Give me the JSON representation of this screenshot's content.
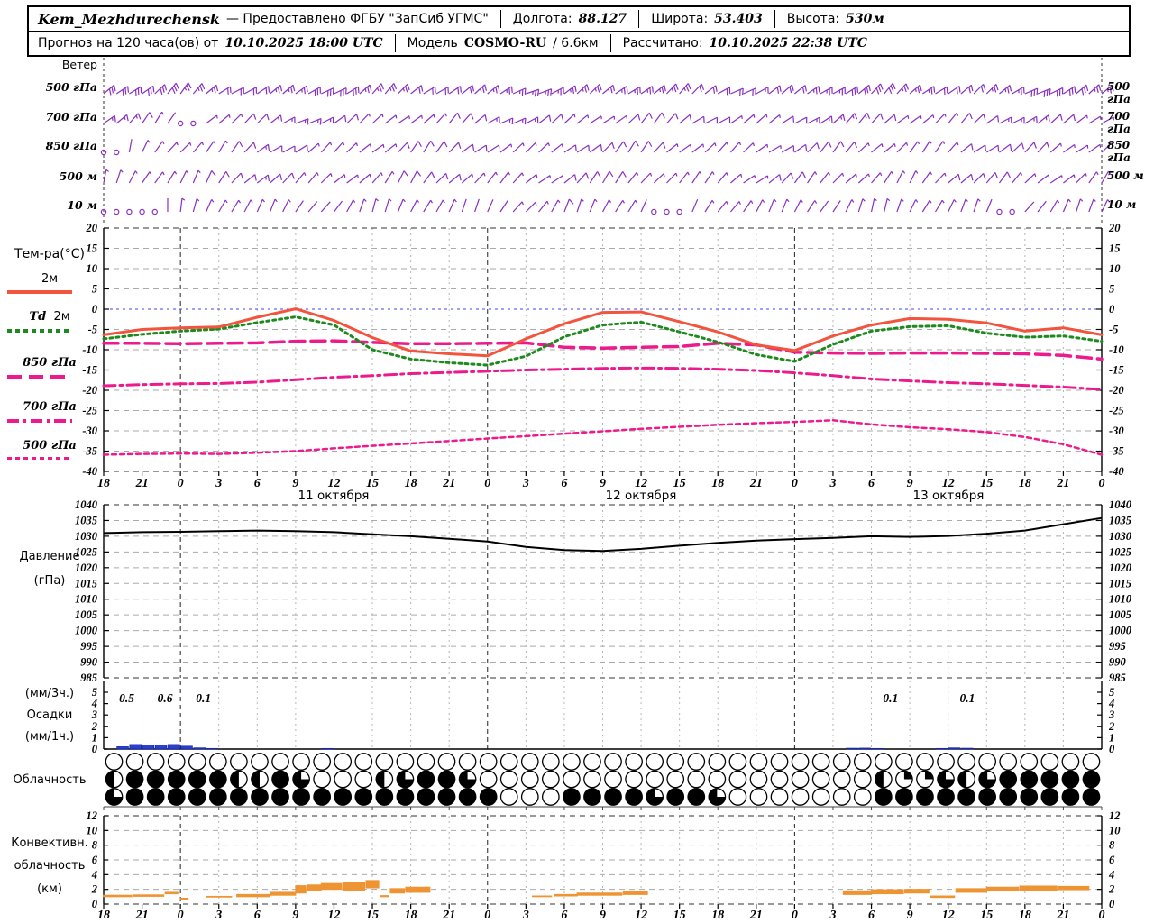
{
  "header": {
    "station": "Kem_Mezhdurechensk",
    "provider": "— Предоставлено ФГБУ \"ЗапСиб УГМС\"",
    "sep": "",
    "lon_label": "Долгота:",
    "lon": "88.127",
    "lat_label": "Широта:",
    "lat": "53.403",
    "alt_label": "Высота:",
    "alt": "530м",
    "forecast_label": "Прогноз на 120 часа(ов) от",
    "forecast_time": "10.10.2025 18:00 UTC",
    "model_label": "Модель",
    "model": "COSMO-RU",
    "model_res": "/ 6.6км",
    "calc_label": "Рассчитано:",
    "calc_time": "10.10.2025 22:38 UTC"
  },
  "sections": {
    "wind_title": "Ветер",
    "temp_title": "Тем-ра(°C)",
    "legend": {
      "t2m": "2м",
      "td_it": "Td",
      "td_rest": "2м",
      "p850": "850 гПа",
      "p700": "700 гПа",
      "p500": "500 гПа"
    },
    "pressure": [
      "Давление",
      "(гПа)"
    ],
    "precip": [
      "(мм/3ч.)",
      "Осадки",
      "(мм/1ч.)"
    ],
    "cloud": "Облачность",
    "conv": [
      "Конвективн.",
      "облачность",
      "(км)"
    ]
  },
  "axis": {
    "hours": [
      "18",
      "21",
      "0",
      "3",
      "6",
      "9",
      "12",
      "15",
      "18",
      "21",
      "0",
      "3",
      "6",
      "9",
      "12",
      "15",
      "18",
      "21",
      "0",
      "3",
      "6",
      "9",
      "12",
      "15",
      "18",
      "21",
      "0"
    ],
    "hour_step": 3,
    "total_hours": 78,
    "dates": [
      "11 октября",
      "12 октября",
      "13 октября"
    ]
  },
  "colors": {
    "wind": "#8a2fc0",
    "t2m": "#f2543d",
    "td": "#1e8a1e",
    "magenta": "#ec1a8c",
    "zero_line": "#4040ff",
    "precip": "#2a3fd4",
    "conv": "#ef9433",
    "grid": "#b5b5b5",
    "grid_major": "#333333"
  },
  "chart_data": [
    {
      "id": "wind",
      "type": "wind-barbs",
      "title": "Ветер",
      "levels": [
        {
          "label": "500 гПа",
          "dirs": [
            50,
            48,
            45,
            50,
            58,
            60,
            55,
            50,
            48,
            52,
            60,
            62,
            58,
            52,
            48,
            50,
            55,
            60,
            58,
            52,
            50,
            48,
            50,
            55,
            58,
            60,
            55
          ],
          "spds": [
            30,
            30,
            28,
            25,
            25,
            28,
            30,
            28,
            25,
            22,
            25,
            28,
            30,
            28,
            25,
            22,
            20,
            22,
            25,
            28,
            30,
            28,
            25,
            25,
            28,
            30,
            28
          ]
        },
        {
          "label": "700 гПа",
          "dirs": [
            45,
            42,
            40,
            45,
            55,
            60,
            58,
            50,
            45,
            48,
            55,
            60,
            55,
            48,
            45,
            50,
            55,
            58,
            55,
            50,
            48,
            45,
            48,
            52,
            55,
            58,
            52
          ],
          "spds": [
            15,
            12,
            0,
            10,
            12,
            15,
            12,
            10,
            8,
            10,
            12,
            15,
            12,
            10,
            8,
            10,
            12,
            10,
            12,
            15,
            12,
            10,
            10,
            12,
            15,
            12,
            10
          ]
        },
        {
          "label": "850 гПа",
          "dirs": [
            0,
            30,
            35,
            40,
            50,
            55,
            50,
            45,
            40,
            45,
            50,
            55,
            50,
            45,
            40,
            45,
            50,
            52,
            50,
            45,
            42,
            40,
            45,
            50,
            52,
            50,
            45
          ],
          "spds": [
            0,
            5,
            8,
            10,
            12,
            10,
            8,
            10,
            12,
            10,
            8,
            10,
            12,
            10,
            8,
            10,
            10,
            8,
            10,
            12,
            10,
            8,
            8,
            10,
            12,
            10,
            8
          ]
        },
        {
          "label": "500 м",
          "dirs": [
            20,
            25,
            30,
            35,
            45,
            50,
            45,
            40,
            35,
            40,
            45,
            50,
            45,
            40,
            35,
            40,
            45,
            48,
            45,
            40,
            38,
            35,
            40,
            45,
            48,
            45,
            40
          ],
          "spds": [
            8,
            8,
            10,
            10,
            12,
            10,
            8,
            8,
            10,
            10,
            8,
            10,
            10,
            8,
            8,
            10,
            10,
            8,
            8,
            10,
            10,
            8,
            8,
            10,
            10,
            8,
            8
          ]
        },
        {
          "label": "10 м",
          "dirs": [
            0,
            0,
            15,
            20,
            30,
            35,
            30,
            25,
            20,
            25,
            30,
            35,
            30,
            25,
            20,
            25,
            30,
            32,
            30,
            25,
            22,
            20,
            25,
            30,
            32,
            30,
            25
          ],
          "spds": [
            0,
            0,
            4,
            5,
            8,
            6,
            5,
            4,
            5,
            6,
            5,
            6,
            8,
            6,
            5,
            4,
            5,
            6,
            5,
            6,
            8,
            6,
            5,
            4,
            5,
            6,
            5
          ]
        }
      ]
    },
    {
      "id": "temperature",
      "type": "line",
      "ylabel": "Тем-ра(°C)",
      "ylim": [
        -40,
        20
      ],
      "ytick": 5,
      "series": [
        {
          "name": "2м",
          "style": "solid",
          "values": [
            -6.3,
            -5.0,
            -4.6,
            -4.4,
            -2.0,
            0.1,
            -2.8,
            -7.0,
            -10.3,
            -11.0,
            -11.5,
            -7.3,
            -3.6,
            -0.8,
            -0.7,
            -3.1,
            -5.6,
            -8.8,
            -10.2,
            -6.6,
            -3.9,
            -2.3,
            -2.5,
            -3.4,
            -5.4,
            -4.6,
            -6.3
          ]
        },
        {
          "name": "Td 2м",
          "style": "dotted",
          "values": [
            -7.3,
            -6.2,
            -5.4,
            -4.9,
            -3.3,
            -1.9,
            -3.9,
            -10.0,
            -12.3,
            -13.2,
            -13.8,
            -11.6,
            -6.8,
            -3.9,
            -3.2,
            -5.6,
            -8.1,
            -11.2,
            -12.9,
            -8.7,
            -5.4,
            -4.3,
            -4.1,
            -5.9,
            -6.9,
            -6.6,
            -7.9
          ]
        },
        {
          "name": "850 гПа",
          "style": "longdash",
          "values": [
            -8.4,
            -8.4,
            -8.5,
            -8.4,
            -8.3,
            -7.9,
            -7.8,
            -8.2,
            -8.5,
            -8.5,
            -8.4,
            -8.3,
            -9.4,
            -9.6,
            -9.4,
            -9.2,
            -8.4,
            -8.8,
            -10.6,
            -10.8,
            -10.9,
            -10.8,
            -10.8,
            -10.9,
            -11.0,
            -11.4,
            -12.3
          ]
        },
        {
          "name": "700 гПа",
          "style": "dashdot",
          "values": [
            -18.9,
            -18.6,
            -18.4,
            -18.3,
            -18.0,
            -17.4,
            -16.8,
            -16.4,
            -15.9,
            -15.6,
            -15.3,
            -15.0,
            -14.8,
            -14.6,
            -14.5,
            -14.6,
            -14.8,
            -15.1,
            -15.7,
            -16.4,
            -17.2,
            -17.7,
            -18.1,
            -18.4,
            -18.8,
            -19.2,
            -19.8
          ]
        },
        {
          "name": "500 гПа",
          "style": "finedash",
          "values": [
            -35.9,
            -35.7,
            -35.6,
            -35.7,
            -35.4,
            -35.0,
            -34.3,
            -33.7,
            -33.1,
            -32.5,
            -31.9,
            -31.3,
            -30.7,
            -30.1,
            -29.5,
            -29.0,
            -28.5,
            -28.1,
            -27.8,
            -27.4,
            -28.4,
            -29.1,
            -29.6,
            -30.3,
            -31.5,
            -33.3,
            -35.9
          ]
        }
      ]
    },
    {
      "id": "pressure",
      "type": "line",
      "ylabel": "Давление (гПа)",
      "ylim": [
        985,
        1040
      ],
      "ytick": 5,
      "series": [
        {
          "name": "Давление",
          "values": [
            1031.0,
            1031.3,
            1031.4,
            1031.6,
            1031.8,
            1031.6,
            1031.3,
            1030.6,
            1030.0,
            1029.2,
            1028.3,
            1026.6,
            1025.6,
            1025.3,
            1026.0,
            1027.0,
            1027.9,
            1028.6,
            1029.1,
            1029.5,
            1030.0,
            1029.8,
            1030.1,
            1030.8,
            1031.8,
            1033.8,
            1035.8
          ]
        }
      ]
    },
    {
      "id": "precip",
      "type": "bar",
      "ylabel": "Осадки (мм/1ч.)",
      "ylim": [
        0,
        5
      ],
      "ytick": 1,
      "bars_1h": [
        [
          1,
          0.2
        ],
        [
          2,
          0.4
        ],
        [
          3,
          0.35
        ],
        [
          4,
          0.35
        ],
        [
          5,
          0.4
        ],
        [
          6,
          0.25
        ],
        [
          7,
          0.1
        ],
        [
          8,
          0.05
        ],
        [
          17,
          0.05
        ],
        [
          58,
          0.07
        ],
        [
          59,
          0.08
        ],
        [
          60,
          0.05
        ],
        [
          65,
          0.05
        ],
        [
          66,
          0.1
        ],
        [
          67,
          0.07
        ]
      ],
      "labels_3h": [
        [
          1.8,
          "0.5"
        ],
        [
          4.8,
          "0.6"
        ],
        [
          7.8,
          "0.1"
        ],
        [
          61.5,
          "0.1"
        ],
        [
          67.5,
          "0.1"
        ]
      ]
    },
    {
      "id": "cloud",
      "type": "cloud-cover",
      "ylabel": "Облачность",
      "fill_unit": "eighths",
      "rows": [
        {
          "values": [
            0,
            0,
            0,
            0,
            0,
            0,
            0,
            0,
            0,
            0,
            0,
            0,
            0,
            0,
            0,
            0,
            0,
            0,
            0,
            0,
            0,
            0,
            0,
            0,
            0,
            0,
            0,
            0,
            0,
            0,
            0,
            0,
            0,
            0,
            0,
            0,
            0,
            0,
            0,
            0,
            0,
            0,
            0,
            0,
            0,
            0,
            0,
            0
          ]
        },
        {
          "values": [
            4,
            8,
            8,
            8,
            8,
            8,
            4,
            4,
            8,
            6,
            0,
            0,
            0,
            4,
            6,
            8,
            8,
            6,
            0,
            0,
            0,
            0,
            0,
            0,
            0,
            0,
            0,
            0,
            0,
            0,
            0,
            0,
            0,
            0,
            0,
            0,
            0,
            4,
            2,
            2,
            6,
            4,
            6,
            8,
            8,
            8,
            8,
            8
          ]
        },
        {
          "values": [
            6,
            8,
            8,
            8,
            8,
            8,
            8,
            8,
            8,
            8,
            8,
            8,
            8,
            8,
            8,
            8,
            8,
            8,
            8,
            0,
            0,
            0,
            8,
            8,
            8,
            8,
            6,
            8,
            8,
            6,
            0,
            0,
            0,
            0,
            0,
            0,
            0,
            8,
            8,
            8,
            8,
            8,
            8,
            8,
            8,
            8,
            8,
            8
          ]
        }
      ]
    },
    {
      "id": "conv",
      "type": "range-bar",
      "ylabel": "Конвективн. облачность (км)",
      "ylim": [
        0,
        12
      ],
      "ytick": 2,
      "bars": [
        [
          0,
          2.2,
          1.0,
          1.2
        ],
        [
          2.3,
          4.7,
          1.05,
          1.25
        ],
        [
          4.8,
          5.8,
          1.4,
          1.6
        ],
        [
          6.0,
          6.6,
          0.6,
          0.8
        ],
        [
          8.0,
          10.0,
          0.95,
          1.05
        ],
        [
          10.4,
          13.0,
          1.0,
          1.3
        ],
        [
          13.0,
          15.0,
          1.2,
          1.6
        ],
        [
          15.0,
          15.8,
          1.5,
          2.5
        ],
        [
          15.9,
          17.0,
          1.9,
          2.6
        ],
        [
          17.0,
          18.6,
          2.0,
          2.8
        ],
        [
          18.7,
          20.4,
          1.9,
          3.0
        ],
        [
          20.5,
          21.5,
          2.2,
          3.2
        ],
        [
          21.6,
          22.3,
          1.0,
          1.15
        ],
        [
          22.4,
          23.5,
          1.5,
          2.1
        ],
        [
          23.6,
          25.5,
          1.6,
          2.3
        ],
        [
          33.5,
          35.0,
          1.0,
          1.1
        ],
        [
          35.2,
          37.0,
          1.1,
          1.3
        ],
        [
          37.0,
          40.5,
          1.2,
          1.5
        ],
        [
          40.6,
          42.5,
          1.3,
          1.65
        ],
        [
          57.8,
          60.0,
          1.3,
          1.8
        ],
        [
          60.0,
          62.5,
          1.4,
          1.95
        ],
        [
          62.6,
          64.5,
          1.5,
          2.0
        ],
        [
          64.6,
          66.5,
          0.9,
          1.1
        ],
        [
          66.6,
          69.0,
          1.6,
          2.1
        ],
        [
          69.0,
          71.5,
          1.85,
          2.3
        ],
        [
          71.6,
          74.5,
          1.9,
          2.45
        ],
        [
          74.6,
          77.0,
          1.95,
          2.4
        ]
      ]
    }
  ]
}
